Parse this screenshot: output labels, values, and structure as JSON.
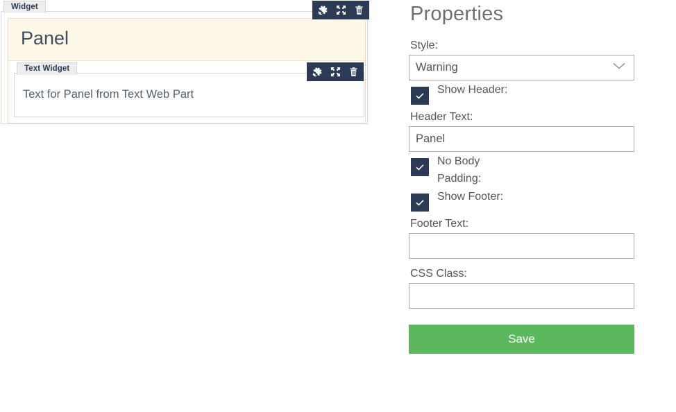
{
  "canvas": {
    "outer_widget": {
      "chip_label": "Widget",
      "toolbar": {
        "settings_icon": "gear-icon",
        "expand_icon": "expand-arrows-icon",
        "delete_icon": "trash-icon"
      },
      "panel": {
        "title": "Panel",
        "style": "warning",
        "header_bg": "#fdf8e8"
      }
    },
    "inner_widget": {
      "chip_label": "Text Widget",
      "toolbar": {
        "settings_icon": "gear-icon",
        "expand_icon": "expand-arrows-icon",
        "delete_icon": "trash-icon"
      },
      "text": "Text for Panel from Text Web Part"
    }
  },
  "properties": {
    "title": "Properties",
    "style": {
      "label": "Style:",
      "selected": "Warning",
      "chevron_icon": "chevron-down-icon"
    },
    "show_header": {
      "label": "Show Header:",
      "checked": true
    },
    "header_text": {
      "label": "Header Text:",
      "value": "Panel",
      "placeholder": ""
    },
    "no_body_padding": {
      "label": "No Body Padding:",
      "checked": true
    },
    "show_footer": {
      "label": "Show Footer:",
      "checked": true
    },
    "footer_text": {
      "label": "Footer Text:",
      "value": "",
      "placeholder": ""
    },
    "css_class": {
      "label": "CSS Class:",
      "value": "",
      "placeholder": ""
    },
    "save_label": "Save"
  },
  "colors": {
    "toolbar_navy": "#2b3a55",
    "checkbox_navy": "#2b3a55",
    "save_green": "#5cb85c",
    "warning_bg": "#fdf8e8",
    "border_gray": "#a9a9a9"
  }
}
